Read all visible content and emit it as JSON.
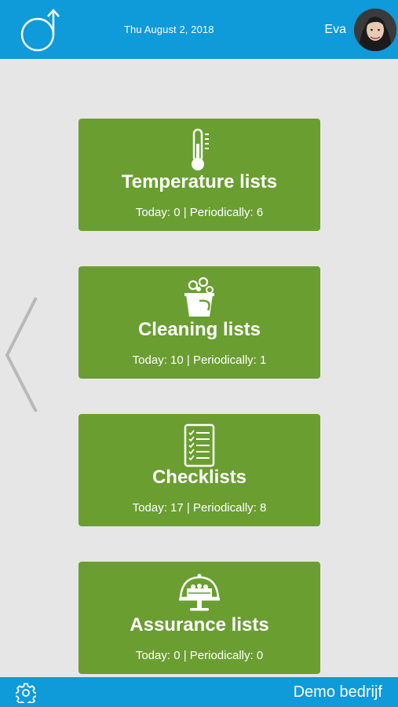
{
  "header": {
    "date": "Thu August 2, 2018",
    "user_name": "Eva",
    "logo_icon": "app-logo-icon",
    "avatar_icon": "user-avatar"
  },
  "navigation": {
    "prev_icon": "chevron-left-icon"
  },
  "cards": [
    {
      "title": "Temperature lists",
      "stats": "Today: 0 | Periodically: 6",
      "icon": "thermometer-icon"
    },
    {
      "title": "Cleaning lists",
      "stats": "Today: 10 | Periodically: 1",
      "icon": "cleaning-bucket-icon"
    },
    {
      "title": "Checklists",
      "stats": "Today: 17 | Periodically: 8",
      "icon": "checklist-icon"
    },
    {
      "title": "Assurance lists",
      "stats": "Today: 0 | Periodically: 0",
      "icon": "cake-stand-icon"
    }
  ],
  "footer": {
    "company": "Demo bedrijf",
    "settings_icon": "gear-icon"
  },
  "colors": {
    "header_bg": "#0f9ad9",
    "card_bg": "#6a9e31",
    "page_bg": "#e6e6e6",
    "text": "#ffffff"
  }
}
